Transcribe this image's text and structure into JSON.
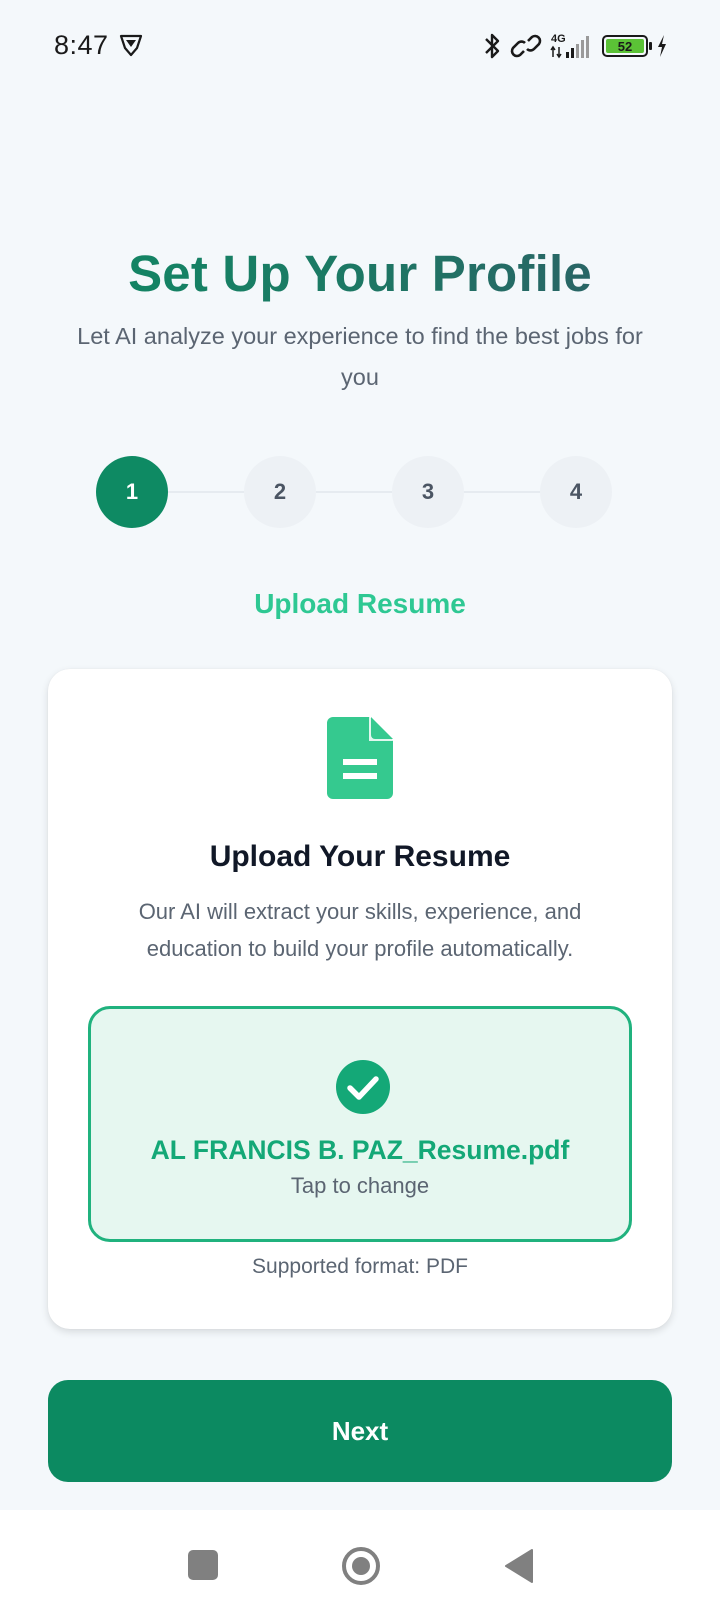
{
  "status_bar": {
    "time": "8:47",
    "battery_level": "52",
    "network": "4G"
  },
  "header": {
    "title": "Set Up Your Profile",
    "subtitle": "Let AI analyze your experience to find the best jobs for you"
  },
  "stepper": {
    "steps": [
      "1",
      "2",
      "3",
      "4"
    ],
    "active_step": 1,
    "current_label": "Upload Resume"
  },
  "card": {
    "icon": "document-icon",
    "title": "Upload Your Resume",
    "description": "Our AI will extract your skills, experience, and education to build your profile automatically.",
    "upload": {
      "status_icon": "check-circle-icon",
      "file_name": "AL FRANCIS B. PAZ_Resume.pdf",
      "hint": "Tap to change"
    },
    "supported_format": "Supported format: PDF"
  },
  "actions": {
    "next_label": "Next"
  },
  "colors": {
    "primary": "#0c8a61",
    "accent": "#2ec893",
    "upload_bg": "#e6f7f0",
    "upload_border": "#20b27e"
  }
}
